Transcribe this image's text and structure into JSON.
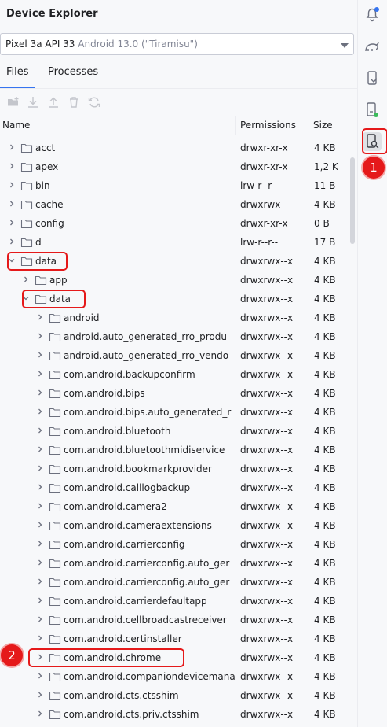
{
  "window": {
    "title": "Device Explorer"
  },
  "device": {
    "name": "Pixel 3a API 33",
    "details": " Android 13.0 (\"Tiramisu\")"
  },
  "tabs": [
    {
      "label": "Files",
      "active": true
    },
    {
      "label": "Processes",
      "active": false
    }
  ],
  "toolbar": [
    "new-folder-icon",
    "download-icon",
    "upload-icon",
    "delete-icon",
    "sync-icon"
  ],
  "columns": {
    "name": "Name",
    "permissions": "Permissions",
    "size": "Size"
  },
  "rows": [
    {
      "name": "acct",
      "perm": "drwxr-xr-x",
      "size": "4 KB",
      "depth": 0,
      "expanded": false
    },
    {
      "name": "apex",
      "perm": "drwxr-xr-x",
      "size": "1,2 K",
      "depth": 0,
      "expanded": false
    },
    {
      "name": "bin",
      "perm": "lrw-r--r--",
      "size": "11 B",
      "depth": 0,
      "expanded": false
    },
    {
      "name": "cache",
      "perm": "drwxrwx---",
      "size": "4 KB",
      "depth": 0,
      "expanded": false
    },
    {
      "name": "config",
      "perm": "drwxr-xr-x",
      "size": "0 B",
      "depth": 0,
      "expanded": false
    },
    {
      "name": "d",
      "perm": "lrw-r--r--",
      "size": "17 B",
      "depth": 0,
      "expanded": false
    },
    {
      "name": "data",
      "perm": "drwxrwx--x",
      "size": "4 KB",
      "depth": 0,
      "expanded": true
    },
    {
      "name": "app",
      "perm": "drwxrwx--x",
      "size": "4 KB",
      "depth": 1,
      "expanded": false
    },
    {
      "name": "data",
      "perm": "drwxrwx--x",
      "size": "4 KB",
      "depth": 1,
      "expanded": true
    },
    {
      "name": "android",
      "perm": "drwxrwx--x",
      "size": "4 KB",
      "depth": 2,
      "expanded": false
    },
    {
      "name": "android.auto_generated_rro_produ",
      "perm": "drwxrwx--x",
      "size": "4 KB",
      "depth": 2,
      "expanded": false
    },
    {
      "name": "android.auto_generated_rro_vendo",
      "perm": "drwxrwx--x",
      "size": "4 KB",
      "depth": 2,
      "expanded": false
    },
    {
      "name": "com.android.backupconfirm",
      "perm": "drwxrwx--x",
      "size": "4 KB",
      "depth": 2,
      "expanded": false
    },
    {
      "name": "com.android.bips",
      "perm": "drwxrwx--x",
      "size": "4 KB",
      "depth": 2,
      "expanded": false
    },
    {
      "name": "com.android.bips.auto_generated_r",
      "perm": "drwxrwx--x",
      "size": "4 KB",
      "depth": 2,
      "expanded": false
    },
    {
      "name": "com.android.bluetooth",
      "perm": "drwxrwx--x",
      "size": "4 KB",
      "depth": 2,
      "expanded": false
    },
    {
      "name": "com.android.bluetoothmidiservice",
      "perm": "drwxrwx--x",
      "size": "4 KB",
      "depth": 2,
      "expanded": false
    },
    {
      "name": "com.android.bookmarkprovider",
      "perm": "drwxrwx--x",
      "size": "4 KB",
      "depth": 2,
      "expanded": false
    },
    {
      "name": "com.android.calllogbackup",
      "perm": "drwxrwx--x",
      "size": "4 KB",
      "depth": 2,
      "expanded": false
    },
    {
      "name": "com.android.camera2",
      "perm": "drwxrwx--x",
      "size": "4 KB",
      "depth": 2,
      "expanded": false
    },
    {
      "name": "com.android.cameraextensions",
      "perm": "drwxrwx--x",
      "size": "4 KB",
      "depth": 2,
      "expanded": false
    },
    {
      "name": "com.android.carrierconfig",
      "perm": "drwxrwx--x",
      "size": "4 KB",
      "depth": 2,
      "expanded": false
    },
    {
      "name": "com.android.carrierconfig.auto_ger",
      "perm": "drwxrwx--x",
      "size": "4 KB",
      "depth": 2,
      "expanded": false
    },
    {
      "name": "com.android.carrierconfig.auto_ger",
      "perm": "drwxrwx--x",
      "size": "4 KB",
      "depth": 2,
      "expanded": false
    },
    {
      "name": "com.android.carrierdefaultapp",
      "perm": "drwxrwx--x",
      "size": "4 KB",
      "depth": 2,
      "expanded": false
    },
    {
      "name": "com.android.cellbroadcastreceiver",
      "perm": "drwxrwx--x",
      "size": "4 KB",
      "depth": 2,
      "expanded": false
    },
    {
      "name": "com.android.certinstaller",
      "perm": "drwxrwx--x",
      "size": "4 KB",
      "depth": 2,
      "expanded": false
    },
    {
      "name": "com.android.chrome",
      "perm": "drwxrwx--x",
      "size": "4 KB",
      "depth": 2,
      "expanded": false
    },
    {
      "name": "com.android.companiondevicemana",
      "perm": "drwxrwx--x",
      "size": "4 KB",
      "depth": 2,
      "expanded": false
    },
    {
      "name": "com.android.cts.ctsshim",
      "perm": "drwxrwx--x",
      "size": "4 KB",
      "depth": 2,
      "expanded": false
    },
    {
      "name": "com.android.cts.priv.ctsshim",
      "perm": "drwxrwx--x",
      "size": "4 KB",
      "depth": 2,
      "expanded": false
    }
  ],
  "sidebar": [
    "notifications-icon",
    "gradle-elephant-icon",
    "device-manager-icon",
    "running-devices-icon",
    "device-explorer-icon"
  ],
  "annotations": [
    {
      "label": "1"
    },
    {
      "label": "2"
    }
  ],
  "colors": {
    "accent": "#3574f0",
    "annotation": "#e5191a"
  }
}
